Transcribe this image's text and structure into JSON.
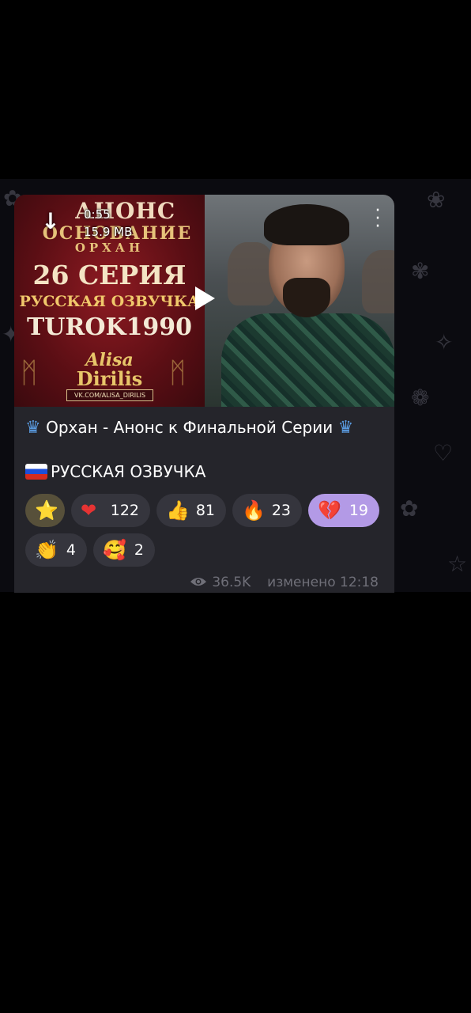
{
  "video": {
    "duration": "0:55",
    "size": "15.9 MB",
    "poster": {
      "anons": "АНОНС",
      "title_word": "ОСНОВАНИЕ",
      "title_name": "ОРХАН",
      "episode": "26 СЕРИЯ",
      "dub": "РУССКАЯ ОЗВУЧКА",
      "turok": "TUROK1990",
      "brand_line1": "Alisa",
      "brand_line2": "Dirilis",
      "vk": "VK.COM/ALISA_DIRILIS"
    }
  },
  "message": {
    "caption_text": "Орхан - Анонс к Финальной Серии",
    "subcaption_text": "РУССКАЯ ОЗВУЧКА",
    "crown_glyph": "♛",
    "flag": "russia-flag-icon"
  },
  "reactions": [
    {
      "emoji": "⭐",
      "icon": "star-icon",
      "count": ""
    },
    {
      "emoji": "❤",
      "icon": "heart-icon",
      "count": "122"
    },
    {
      "emoji": "👍",
      "icon": "thumbs-up-icon",
      "count": "81"
    },
    {
      "emoji": "🔥",
      "icon": "fire-icon",
      "count": "23"
    },
    {
      "emoji": "💔",
      "icon": "broken-heart-icon",
      "count": "19"
    },
    {
      "emoji": "👏",
      "icon": "clapping-icon",
      "count": "4"
    },
    {
      "emoji": "🥰",
      "icon": "smiling-hearts-icon",
      "count": "2"
    }
  ],
  "footer": {
    "views": "36.5K",
    "edited": "изменено 12:18"
  },
  "colors": {
    "bubble": "#25252b",
    "accent_reaction": "#b39ae6",
    "crown": "#5a9be0",
    "meta": "#6f6f78"
  }
}
